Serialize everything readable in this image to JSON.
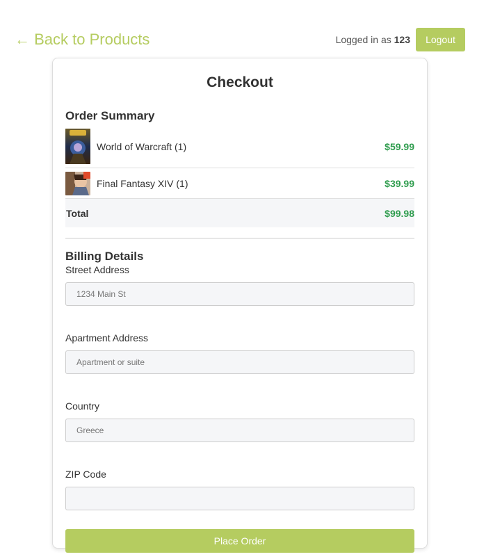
{
  "header": {
    "back_link": "← Back to Products",
    "logged_in_prefix": "Logged in as",
    "username": "123",
    "logout_label": "Logout"
  },
  "checkout": {
    "title": "Checkout",
    "order_summary_title": "Order Summary",
    "items": [
      {
        "name": "World of Warcraft (1)",
        "price": "$59.99",
        "thumbnail": "world-of-warcraft-cover-image"
      },
      {
        "name": "Final Fantasy XIV (1)",
        "price": "$39.99",
        "thumbnail": "final-fantasy-xiv-cover-image"
      }
    ],
    "total_label": "Total",
    "total_value": "$99.98",
    "billing_title": "Billing Details",
    "fields": [
      {
        "label": "Street Address",
        "value": "",
        "placeholder": "1234 Main St"
      },
      {
        "label": "Apartment Address",
        "value": "",
        "placeholder": "Apartment or suite"
      },
      {
        "label": "Country",
        "value": "",
        "placeholder": "Greece"
      },
      {
        "label": "ZIP Code",
        "value": "",
        "placeholder": ""
      }
    ],
    "submit_label": "Place Order"
  },
  "colors": {
    "accent": "#b5cc60",
    "price": "#2e9c4d",
    "input_background": "#f5f6f8"
  }
}
